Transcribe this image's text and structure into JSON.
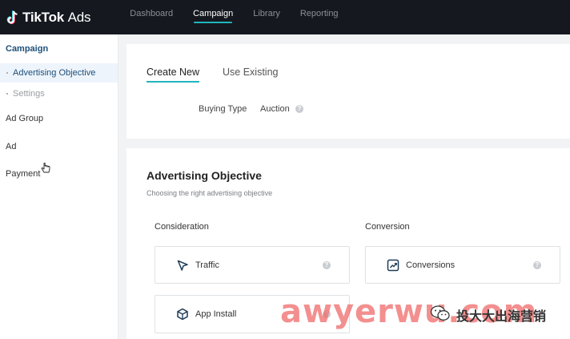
{
  "header": {
    "logo_brand": "TikTok",
    "logo_suffix": "Ads",
    "nav": [
      "Dashboard",
      "Campaign",
      "Library",
      "Reporting"
    ],
    "active_nav": "Campaign",
    "accent_color": "#22b5bd",
    "bg_color": "#15181f"
  },
  "sidebar": {
    "campaign": "Campaign",
    "sub_items": [
      "Advertising Objective",
      "Settings"
    ],
    "items": [
      "Ad Group",
      "Ad",
      "Payment"
    ]
  },
  "top_card": {
    "tabs": [
      "Create New",
      "Use Existing"
    ],
    "buying_type_label": "Buying Type",
    "buying_type_value": "Auction",
    "help_glyph": "?"
  },
  "objective": {
    "title": "Advertising Objective",
    "subtitle": "Choosing the right advertising objective",
    "groups": [
      "Consideration",
      "Conversion"
    ],
    "options": {
      "traffic": "Traffic",
      "conversions": "Conversions",
      "app_install": "App Install"
    }
  },
  "watermark": {
    "main": "awyerwu.com",
    "side": "投大大出海营销"
  }
}
